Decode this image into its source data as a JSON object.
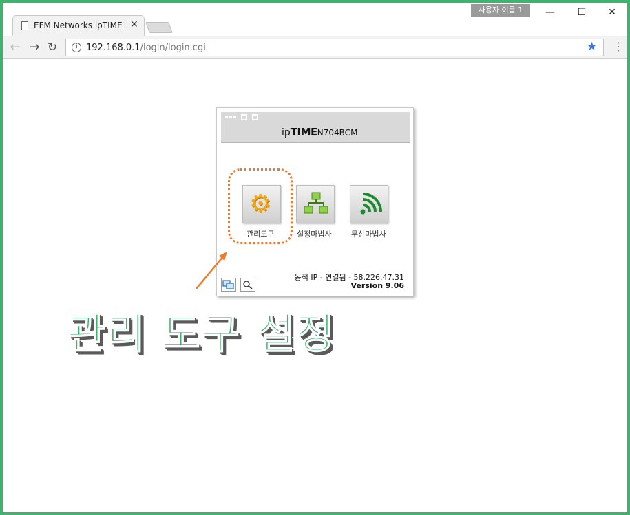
{
  "window": {
    "user_badge": "사용자 이름 1",
    "minimize": "—",
    "maximize": "☐",
    "close": "✕"
  },
  "tab": {
    "title": "EFM Networks ipTIME N",
    "close": "✕"
  },
  "address_bar": {
    "host": "192.168.0.1",
    "path": "/login/login.cgi"
  },
  "card": {
    "brand_prefix": "ip",
    "brand_main": "TIME",
    "model": "N704BCM",
    "menus": [
      {
        "label": "관리도구",
        "icon": "gear-icon"
      },
      {
        "label": "설정마법사",
        "icon": "network-tree-icon"
      },
      {
        "label": "무선마법사",
        "icon": "wireless-icon"
      }
    ],
    "status": "동적 IP - 연결됨 - 58.226.47.31",
    "version": "Version 9.06"
  },
  "annotation": {
    "caption": "관리 도구 설정",
    "accent_color": "#3cb46e",
    "highlight_color": "#f07a2a"
  }
}
